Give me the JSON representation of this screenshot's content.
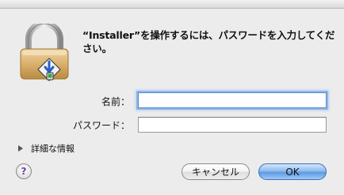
{
  "dialog": {
    "message": "“Installer”を操作するには、パスワードを入力してください。"
  },
  "icons": {
    "lock": "lock-installer-icon",
    "disclosure": "disclosure-triangle-right-icon",
    "help": "help-question-icon"
  },
  "form": {
    "name_label": "名前：",
    "name_value": "",
    "password_label": "パスワード：",
    "password_value": ""
  },
  "details": {
    "label": "詳細な情報"
  },
  "help": {
    "glyph": "?"
  },
  "buttons": {
    "cancel_label": "キャンセル",
    "ok_label": "OK"
  },
  "colors": {
    "window_bg": "#ececec",
    "focus_ring": "#8fb6e8",
    "default_button": "#5d9ae2",
    "help_glyph": "#6a3fa0"
  }
}
